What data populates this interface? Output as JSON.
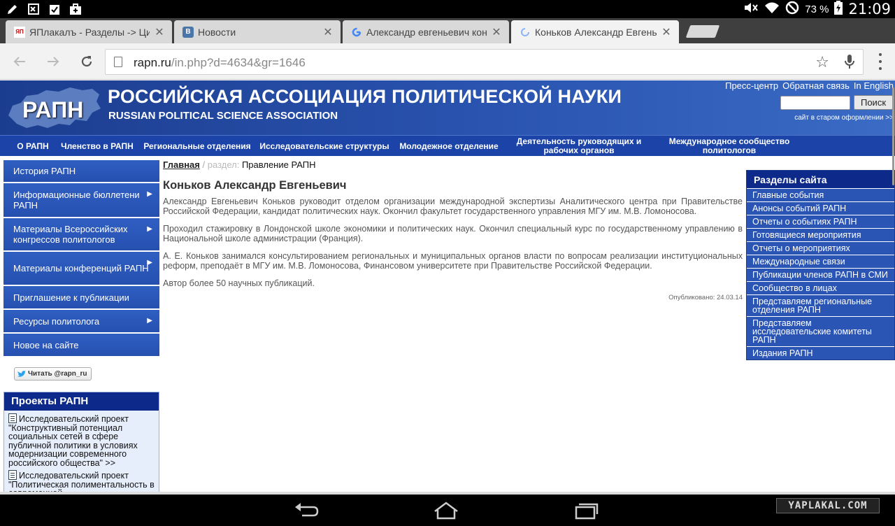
{
  "status_bar": {
    "battery": "73 %",
    "time": "21:09"
  },
  "tabs": [
    {
      "title": "ЯПлакалъ - Разделы -> Цит",
      "favicon": "yaplakal-icon"
    },
    {
      "title": "Новости",
      "favicon": "vk-icon"
    },
    {
      "title": "Александр евгеньевич кон",
      "favicon": "google-icon"
    },
    {
      "title": "Коньков Александр Евгень",
      "favicon": "loading-icon"
    }
  ],
  "omnibox": {
    "domain": "rapn.ru",
    "path": "/in.php?d=4634&gr=1646"
  },
  "header": {
    "logo": "РАПН",
    "title": "РОССИЙСКАЯ АССОЦИАЦИЯ ПОЛИТИЧЕСКОЙ НАУКИ",
    "subtitle": "RUSSIAN POLITICAL SCIENCE ASSOCIATION",
    "links": [
      "Пресс-центр",
      "Обратная связь",
      "In English"
    ],
    "search_button": "Поиск",
    "old_site": "сайт в старом оформлении >>"
  },
  "main_nav": [
    "О РАПН",
    "Членство в РАПН",
    "Региональные отделения",
    "Исследовательские структуры",
    "Молодежное отделение",
    "Деятельность руководящих и рабочих органов",
    "Международное сообщество политологов"
  ],
  "left_nav": [
    {
      "label": "История РАПН",
      "has_submenu": false
    },
    {
      "label": "Информационные бюллетени РАПН",
      "has_submenu": true
    },
    {
      "label": "Материалы Всероссийских конгрессов политологов",
      "has_submenu": true
    },
    {
      "label": "Материалы конференций РАПН",
      "has_submenu": true
    },
    {
      "label": "Приглашение к публикации",
      "has_submenu": false
    },
    {
      "label": "Ресурсы политолога",
      "has_submenu": true
    },
    {
      "label": "Новое на сайте",
      "has_submenu": false
    }
  ],
  "twitter": {
    "label": "Читать @rapn_ru"
  },
  "projects": {
    "heading": "Проекты РАПН",
    "items": [
      "Исследовательский проект \"Конструктивный потенциал социальных сетей в сфере публичной политики в условиях модернизации современного российского общества\" >>",
      "Исследовательский проект \"Политическая полиментальность в современной"
    ]
  },
  "article": {
    "breadcrumb_home": "Главная",
    "breadcrumb_sep": "/",
    "breadcrumb_section": "раздел:",
    "breadcrumb_current": "Правление РАПН",
    "title": "Коньков Александр Евгеньевич",
    "paragraphs": [
      "Александр Евгеньевич Коньков руководит отделом организации международной экспертизы Аналитического центра при Правительстве Российской Федерации, кандидат политических наук. Окончил факультет государственного управления МГУ им. М.В. Ломоносова.",
      "Проходил стажировку в Лондонской школе экономики и политических наук. Окончил специальный курс по государственному управлению в Национальной школе администрации (Франция).",
      "А. Е. Коньков занимался консультированием региональных и муниципальных органов власти по вопросам реализации институциональных реформ, преподаёт в МГУ им. М.В. Ломоносова, Финансовом университете при Правительстве Российской Федерации.",
      "Автор более 50 научных публикаций."
    ],
    "published": "Опубликовано: 24.03.14"
  },
  "right_nav": {
    "heading": "Разделы сайта",
    "items": [
      "Главные события",
      "Анонсы событий РАПН",
      "Отчеты о событиях РАПН",
      "Готовящиеся мероприятия",
      "Отчеты о мероприятиях",
      "Международные связи",
      "Публикации членов РАПН в СМИ",
      "Сообщество в лицах",
      "Представляем региональные отделения РАПН",
      "Представляем исследовательские комитеты РАПН",
      "Издания РАПН"
    ]
  },
  "watermark": "YAPLAKAL.COM",
  "colors": {
    "header_blue": "#2a54b0",
    "nav_blue": "#1c44a8",
    "panel_dark": "#0d2a8a",
    "menu_blue": "#2b55b4"
  }
}
